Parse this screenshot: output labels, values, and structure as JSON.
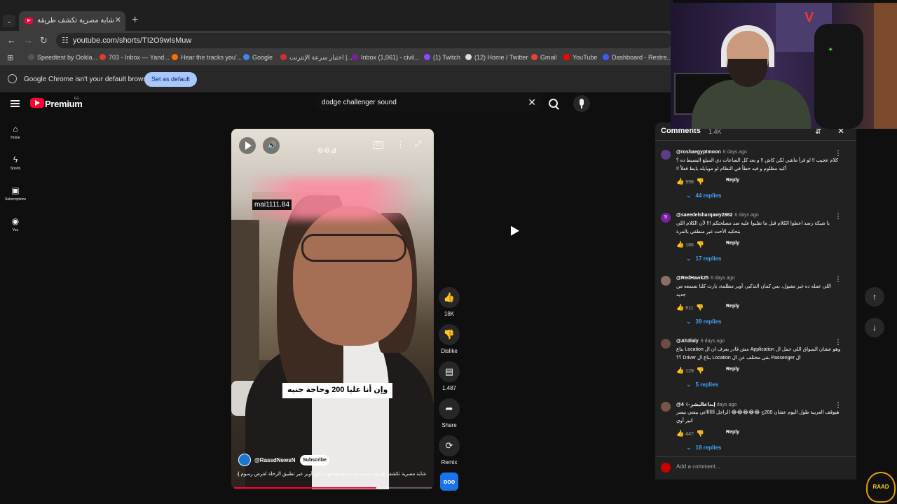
{
  "browser": {
    "tab_title": "شابة مصرية تكشف طريقة نصب",
    "url": "youtube.com/shorts/TI2O9wIsMuw",
    "bookmarks": [
      {
        "label": "Speedtest by Ookla...",
        "color": "#555555"
      },
      {
        "label": "703 - Inbox — Yand...",
        "color": "#e53935"
      },
      {
        "label": "Hear the tracks you'...",
        "color": "#ff6d00"
      },
      {
        "label": "Google",
        "color": "#4285f4"
      },
      {
        "label": "اختبار سرعة الإنترنت |...",
        "color": "#d32f2f"
      },
      {
        "label": "Inbox (1,061) - civil...",
        "color": "#7b1fa2"
      },
      {
        "label": "(1) Twitch",
        "color": "#9146ff"
      },
      {
        "label": "(12) Home / Twitter",
        "color": "#000000"
      },
      {
        "label": "Gmail",
        "color": "#ea4335"
      },
      {
        "label": "YouTube",
        "color": "#ff0000"
      },
      {
        "label": "Dashboard - Restre...",
        "color": "#3d5afe"
      }
    ],
    "infobar_message": "Google Chrome isn't your default browser",
    "set_default_label": "Set as default"
  },
  "youtube": {
    "brand": "Premium",
    "country_code": "EG",
    "sidebar": [
      {
        "label": "Home",
        "icon": "home-icon"
      },
      {
        "label": "Shorts",
        "icon": "shorts-icon"
      },
      {
        "label": "Subscriptions",
        "icon": "subscriptions-icon"
      },
      {
        "label": "You",
        "icon": "you-icon"
      }
    ],
    "search_query": "dodge challenger sound"
  },
  "short": {
    "overlay_tag": "mai1111.84",
    "caption": "وإن أنا عليا 200 وحاجة جنيه",
    "channel": "@RassdNewsN",
    "subscribe_label": "Subscribe",
    "description": "شابة مصرية تكشف طريقة نصب جديدة يستخدمها سائق أوبر عبر تطبيق الرحلة لفرض رسوم إضافية",
    "progress": 0.72,
    "actions": {
      "likes": "18K",
      "dislike": "Dislike",
      "comments": "1,487",
      "share": "Share",
      "remix": "Remix"
    },
    "channel_badge": "ooo"
  },
  "comments_panel": {
    "title": "Comments",
    "count": "1.4K",
    "add_placeholder": "Add a comment...",
    "reply_label": "Reply",
    "items": [
      {
        "author": "@roshaegyptmoon",
        "time": "6 days ago",
        "avatar_color": "#5c3d8a",
        "avatar_letter": "",
        "text": "كلام عجيب !! لو قرأ ماشي لكن كاش !! و بعد كل الساعات دي المبلغ البسيط ده ؟ أكيد مظلوم و فيه خطأ في النظام لو موبايله بايظ فعلاً !!",
        "likes": "998",
        "replies": "44 replies"
      },
      {
        "author": "@saeedelsharqawy2662",
        "time": "6 days ago",
        "avatar_color": "#7b1fa2",
        "avatar_letter": "S",
        "text": "يا شبكة رصد اعطوا الكلام قبل ما تقلبوا عليه ضد مصلحتكم !!! لأن الكلام اللي بتحكيه الأخت غير منطقي بالمرة",
        "likes": "186",
        "replies": "17 replies"
      },
      {
        "author": "@RedHawk25",
        "time": "6 days ago",
        "avatar_color": "#8d6e63",
        "avatar_letter": "",
        "text": "اللي عمله ده غير مقبول، بس كمان التذكير، أوبر مظلمة، يارت كلنا نسمعه من جديد",
        "likes": "811",
        "replies": "39 replies"
      },
      {
        "author": "@Ah3laly",
        "time": "6 days ago",
        "avatar_color": "#6d4c41",
        "avatar_letter": "",
        "text": "وهو عشان السواق اللي حمل ال Application مش قادر يعرف ان ال Location بتاع ال Passenger بقى مختلف عن ال Location بتاع ال Driver ؟؟",
        "likes": "129",
        "replies": "5 replies"
      },
      {
        "author": "@إبداعالبشر-4",
        "time": "6 days ago",
        "avatar_color": "#795548",
        "avatar_letter": "",
        "text": "هيوقف العربية طول اليوم عشان 200ج 😂😂😂😂😂 الراجل اااااااتي بيفتي بيسر كبير أوي",
        "likes": "447",
        "replies": "18 replies"
      }
    ]
  },
  "overlay": {
    "streamer_logo": "V",
    "watermark": "RAAD"
  }
}
